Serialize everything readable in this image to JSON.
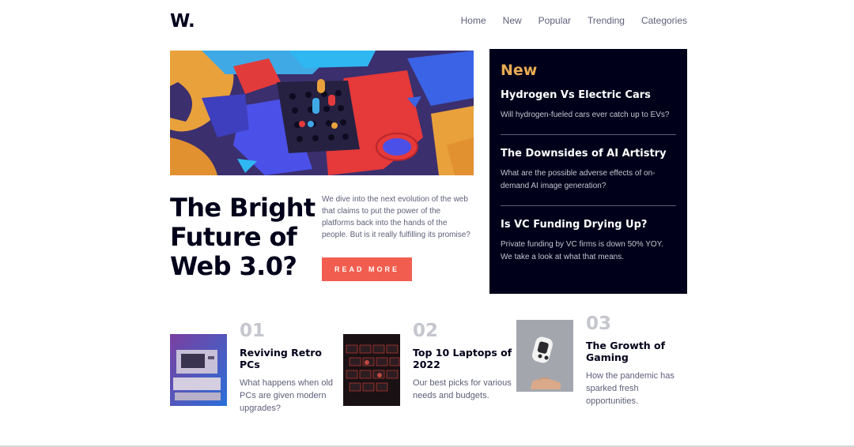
{
  "logo": "W.",
  "nav": [
    "Home",
    "New",
    "Popular",
    "Trending",
    "Categories"
  ],
  "hero": {
    "image_icon": "abstract-3d-blocks-image",
    "headline": "The Bright Future of Web 3.0?",
    "intro": "We dive into the next evolution of the web that claims to put the power of the platforms back into the hands of the people. But is it really fulfilling its promise?",
    "button": "READ MORE"
  },
  "new": {
    "title": "New",
    "items": [
      {
        "title": "Hydrogen Vs Electric Cars",
        "desc": "Will hydrogen-fueled cars ever catch up to EVs?"
      },
      {
        "title": "The Downsides of AI Artistry",
        "desc": "What are the possible adverse effects of on-demand AI image generation?"
      },
      {
        "title": "Is VC Funding Drying Up?",
        "desc": "Private funding by VC firms is down 50% YOY. We take a look at what that means."
      }
    ]
  },
  "articles": [
    {
      "num": "01",
      "title": "Reviving Retro PCs",
      "desc": "What happens when old PCs are given modern upgrades?"
    },
    {
      "num": "02",
      "title": "Top 10 Laptops of 2022",
      "desc": "Our best picks for various needs and budgets."
    },
    {
      "num": "03",
      "title": "The Growth of Gaming",
      "desc": "How the pandemic has sparked fresh opportunities."
    }
  ],
  "colors": {
    "accent": "#f15e50",
    "gold": "#e9ab53",
    "dark": "#00001a",
    "gray": "#5d5f79"
  }
}
